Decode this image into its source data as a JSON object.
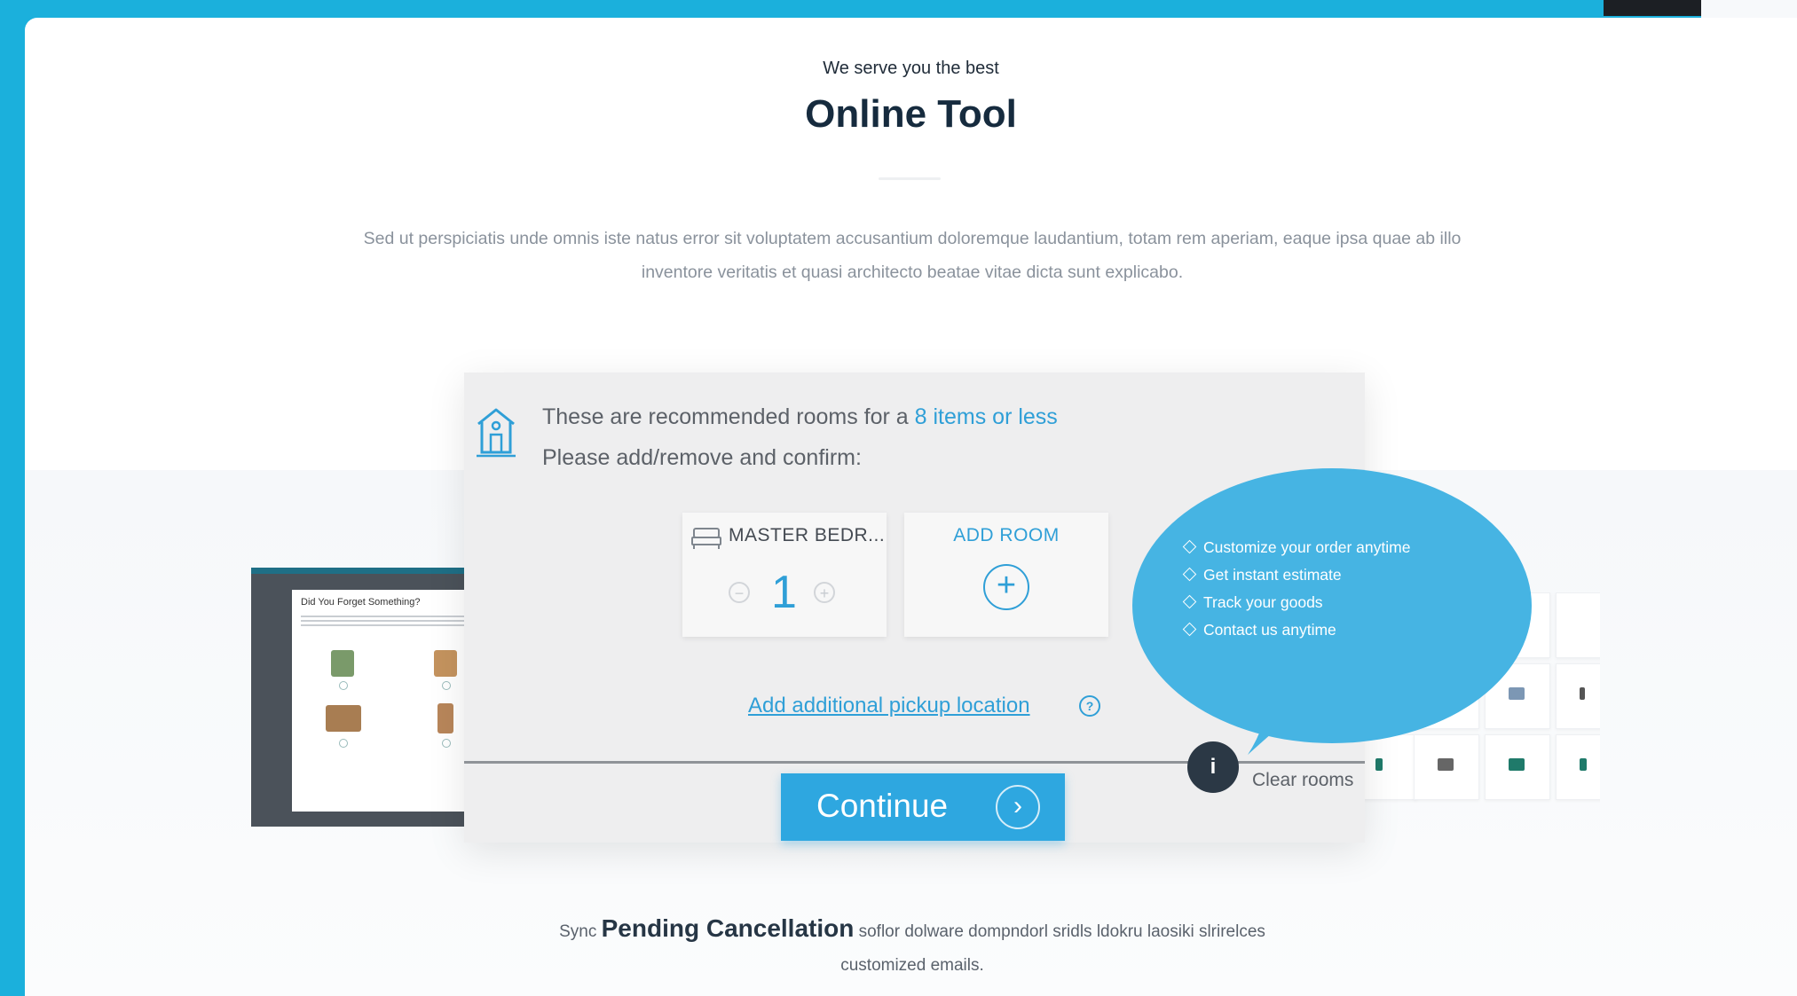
{
  "header": {
    "eyebrow": "We serve you the best",
    "title": "Online Tool"
  },
  "intro": {
    "line1": "Sed ut perspiciatis unde omnis iste natus error sit voluptatem accusantium doloremque laudantium, totam rem aperiam, eaque ipsa quae ab illo",
    "line2": "inventore veritatis et quasi architecto beatae vitae dicta sunt explicabo."
  },
  "tool": {
    "recommend_prefix": "These are recommended rooms for a ",
    "recommend_link": "8 items or less",
    "confirm": "Please add/remove and confirm:",
    "room": {
      "label": "MASTER BEDR...",
      "count": "1",
      "minus": "−",
      "plus": "+"
    },
    "add_room": {
      "label": "ADD ROOM",
      "plus": "+"
    },
    "pickup_link": "Add additional pickup location",
    "help": "?",
    "continue_label": "Continue",
    "continue_arrow": "›",
    "info": "i",
    "clear_rooms": "Clear rooms"
  },
  "bubble": {
    "items": [
      "Customize your order anytime",
      "Get instant estimate",
      "Track your goods",
      "Contact us anytime"
    ]
  },
  "preview": {
    "title": "Did You Forget Something?"
  },
  "footer": {
    "prefix": "Sync ",
    "highlight": "Pending Cancellation",
    "rest": " soflor dolware dompndorl sridls ldokru laosiki slrirelces",
    "line2": "customized emails."
  },
  "colors": {
    "accent": "#2f9fd7",
    "frame": "#1bb0dc",
    "bubble": "#46b4e3",
    "dark": "#2b3845"
  }
}
